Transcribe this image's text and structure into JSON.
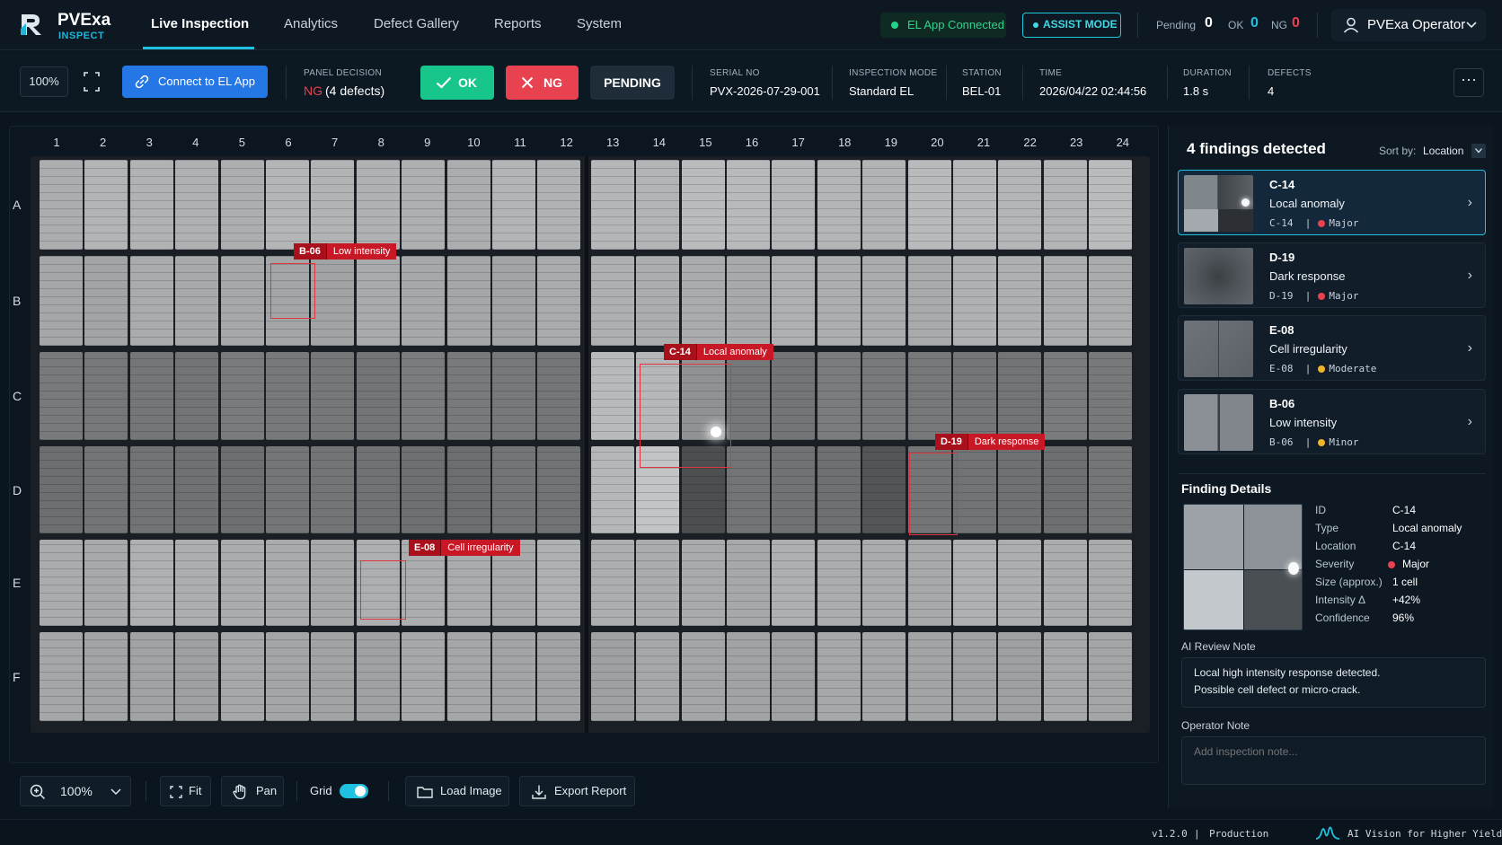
{
  "app": {
    "name": "PVExa",
    "sub": "INSPECT"
  },
  "nav": {
    "tabs": [
      "Live Inspection",
      "Analytics",
      "Defect Gallery",
      "Reports",
      "System"
    ],
    "active": "Live Inspection",
    "connection": "EL App Connected",
    "assist": "ASSIST MODE",
    "pending_label": "Pending",
    "pending_value": "0",
    "ok_label": "OK",
    "ok_value": "0",
    "ng_label": "NG",
    "ng_value": "0",
    "user": "PVExa Operator"
  },
  "toolbar": {
    "zoom": "100%",
    "connect": "Connect to EL App",
    "panel_decision_label": "PANEL DECISION",
    "panel_decision_status": "NG",
    "panel_decision_detail": "(4 defects)",
    "ok": "OK",
    "ng": "NG",
    "pending": "PENDING",
    "serial_label": "SERIAL NO",
    "serial": "PVX-2026-07-29-001",
    "mode_label": "INSPECTION MODE",
    "mode": "Standard EL",
    "station_label": "STATION",
    "station": "BEL-01",
    "time_label": "TIME",
    "time": "2026/04/22 02:44:56",
    "duration_label": "DURATION",
    "duration": "1.8 s",
    "defects_label": "DEFECTS",
    "defects": "4",
    "more": "···"
  },
  "grid": {
    "columns": [
      "1",
      "2",
      "3",
      "4",
      "5",
      "6",
      "7",
      "8",
      "9",
      "10",
      "11",
      "12",
      "13",
      "14",
      "15",
      "16",
      "17",
      "18",
      "19",
      "20",
      "21",
      "22",
      "23",
      "24"
    ],
    "rows": [
      "A",
      "B",
      "C",
      "D",
      "E",
      "F"
    ]
  },
  "defects": [
    {
      "id": "B-06",
      "type": "Low intensity"
    },
    {
      "id": "C-14",
      "type": "Local anomaly"
    },
    {
      "id": "D-19",
      "type": "Dark response"
    },
    {
      "id": "E-08",
      "type": "Cell irregularity"
    }
  ],
  "bottombar": {
    "zoom": "100%",
    "fit": "Fit",
    "pan": "Pan",
    "grid": "Grid",
    "grid_on": true,
    "load": "Load Image",
    "export": "Export Report"
  },
  "footer": {
    "version": "v1.2.0",
    "sep": "|",
    "env": "Production",
    "tagline": "AI Vision for Higher Yield"
  },
  "findings": {
    "count": "4",
    "title_suffix": "findings detected",
    "sort_label": "Sort by:",
    "sort_value": "Location",
    "items": [
      {
        "id": "C-14",
        "type": "Local anomaly",
        "loc": "C-14",
        "sep": "|",
        "severity": "Major",
        "color": "#e8414f"
      },
      {
        "id": "D-19",
        "type": "Dark response",
        "loc": "D-19",
        "sep": "|",
        "severity": "Major",
        "color": "#e8414f"
      },
      {
        "id": "E-08",
        "type": "Cell irregularity",
        "loc": "E-08",
        "sep": "|",
        "severity": "Moderate",
        "color": "#f0b429"
      },
      {
        "id": "B-06",
        "type": "Low intensity",
        "loc": "B-06",
        "sep": "|",
        "severity": "Minor",
        "color": "#f0b429"
      }
    ]
  },
  "details": {
    "title": "Finding Details",
    "fields": [
      {
        "k": "ID",
        "v": "C-14"
      },
      {
        "k": "Type",
        "v": "Local anomaly"
      },
      {
        "k": "Location",
        "v": "C-14"
      },
      {
        "k": "Severity",
        "v": "Major"
      },
      {
        "k": "Size (approx.)",
        "v": "1 cell"
      },
      {
        "k": "Intensity Δ",
        "v": "+42%"
      },
      {
        "k": "Confidence",
        "v": "96%"
      }
    ],
    "ai_label": "AI Review Note",
    "ai_note_1": "Local high intensity response detected.",
    "ai_note_2": "Possible cell defect or micro-crack.",
    "op_label": "Operator Note",
    "op_placeholder": "Add inspection note..."
  },
  "colors": {
    "accent": "#1fc1e0",
    "ok": "#18c58a",
    "ng": "#e8414f",
    "major": "#e8414f",
    "minor": "#f0b429",
    "primary": "#2577e6"
  }
}
